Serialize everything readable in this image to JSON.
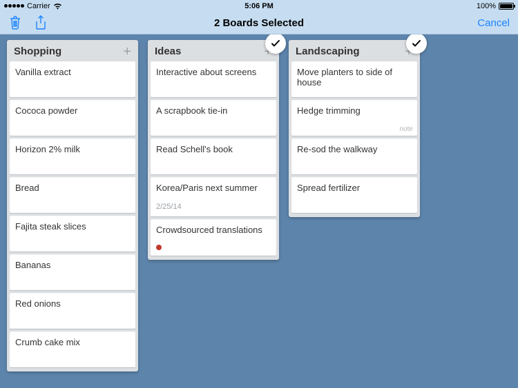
{
  "statusbar": {
    "carrier": "Carrier",
    "time": "5:06 PM",
    "battery_pct": "100%"
  },
  "navbar": {
    "title": "2 Boards Selected",
    "cancel": "Cancel"
  },
  "boards": [
    {
      "title": "Shopping",
      "selected": false,
      "cards": [
        {
          "text": "Vanilla extract"
        },
        {
          "text": "Cococa powder"
        },
        {
          "text": "Horizon 2% milk"
        },
        {
          "text": "Bread"
        },
        {
          "text": "Fajita steak slices"
        },
        {
          "text": "Bananas"
        },
        {
          "text": "Red onions"
        },
        {
          "text": "Crumb cake mix"
        }
      ]
    },
    {
      "title": "Ideas",
      "selected": true,
      "cards": [
        {
          "text": "Interactive about screens"
        },
        {
          "text": "A scrapbook tie-in"
        },
        {
          "text": "Read Schell's book"
        },
        {
          "text": "Korea/Paris next summer",
          "date": "2/25/14"
        },
        {
          "text": "Crowdsourced translations",
          "dot": true
        }
      ]
    },
    {
      "title": "Landscaping",
      "selected": true,
      "cards": [
        {
          "text": "Move planters to side of house"
        },
        {
          "text": "Hedge trimming",
          "note": "note"
        },
        {
          "text": "Re-sod the walkway"
        },
        {
          "text": "Spread fertilizer"
        }
      ]
    }
  ]
}
